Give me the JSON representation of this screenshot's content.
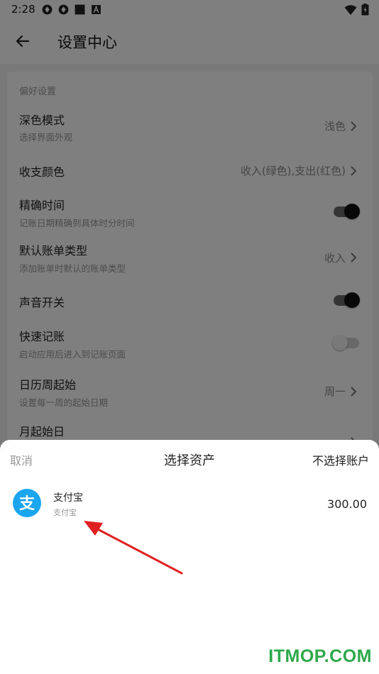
{
  "status_bar": {
    "time": "2:28",
    "left_icons": [
      "sync-icon",
      "sync-icon",
      "square-icon",
      "text-a-icon"
    ],
    "right_icons": [
      "wifi-icon",
      "battery-icon"
    ]
  },
  "app_bar": {
    "back_icon": "back-arrow-icon",
    "title": "设置中心"
  },
  "settings": {
    "section_title": "偏好设置",
    "items": [
      {
        "title": "深色模式",
        "subtitle": "选择界面外观",
        "value": "浅色",
        "control": "chevron"
      },
      {
        "title": "收支颜色",
        "subtitle": "",
        "value": "收入(绿色),支出(红色)",
        "control": "chevron"
      },
      {
        "title": "精确时间",
        "subtitle": "记账日期精确到具体时分时间",
        "value": "",
        "control": "switch",
        "on": true
      },
      {
        "title": "默认账单类型",
        "subtitle": "添加账单时默认的账单类型",
        "value": "收入",
        "control": "chevron"
      },
      {
        "title": "声音开关",
        "subtitle": "",
        "value": "",
        "control": "switch",
        "on": true
      },
      {
        "title": "快速记账",
        "subtitle": "启动应用后进入到记账页面",
        "value": "",
        "control": "switch",
        "on": false
      },
      {
        "title": "日历周起始",
        "subtitle": "设置每一周的起始日期",
        "value": "周一",
        "control": "chevron"
      },
      {
        "title": "月起始日",
        "subtitle": "",
        "value": "",
        "control": "chevron"
      }
    ]
  },
  "sheet": {
    "cancel_label": "取消",
    "title": "选择资产",
    "none_label": "不选择账户",
    "assets": [
      {
        "name": "支付宝",
        "subtitle": "支付宝",
        "amount": "300.00",
        "icon": "alipay-icon",
        "icon_color": "#1aa5ef",
        "icon_glyph": "支"
      }
    ]
  },
  "annotation": {
    "arrow_color": "#e02020"
  },
  "watermark": {
    "text": "ITMOP.COM",
    "color": "#2ea84a"
  },
  "colors": {
    "switch_on_knob": "#111111",
    "dim_overlay": "rgba(0,0,0,0.5)"
  }
}
